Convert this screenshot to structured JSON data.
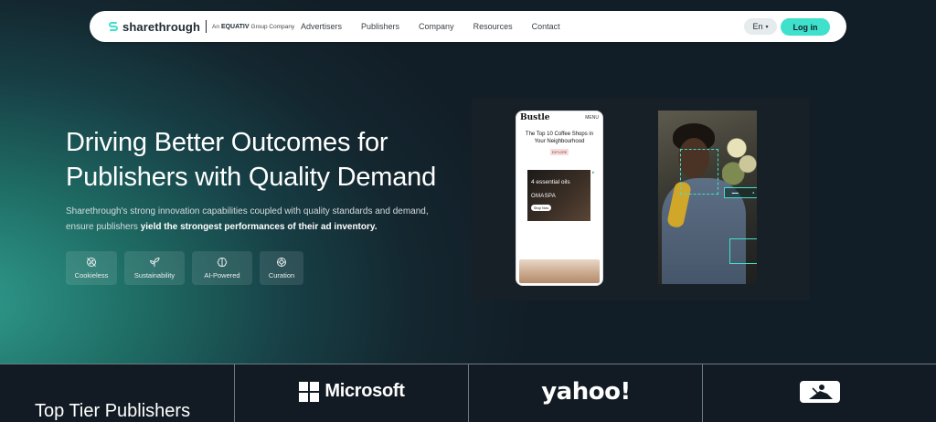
{
  "nav": {
    "brand": "sharethrough",
    "brand_sub_prefix": "An",
    "brand_sub_company": "EQUATIV",
    "brand_sub_suffix": "Group Company",
    "links": [
      "Advertisers",
      "Publishers",
      "Company",
      "Resources",
      "Contact"
    ],
    "language": "En",
    "login_label": "Log in",
    "accent_color": "#3fe0cc"
  },
  "hero": {
    "headline_line1": "Driving Better Outcomes for",
    "headline_line2": "Publishers with Quality Demand",
    "description_lead": "Sharethrough's strong innovation capabilities coupled with quality standards and demand, ensure publishers ",
    "description_bold": "yield the strongest performances of their ad inventory.",
    "features": [
      {
        "label": "Cookieless",
        "icon": "cookieless-icon"
      },
      {
        "label": "Sustainability",
        "icon": "sprout-icon"
      },
      {
        "label": "AI-Powered",
        "icon": "brain-icon"
      },
      {
        "label": "Curation",
        "icon": "curation-icon"
      }
    ]
  },
  "showcase": {
    "phone_brand": "Bustle",
    "phone_menu": "MENU",
    "phone_title": "The Top 10 Coffee Shops in Your Neighbourhood",
    "phone_button": "EXPLORE",
    "ad_big_text": "4 essential oils",
    "ad_brand": "OMASPA",
    "ad_cta": "Shop Now"
  },
  "publishers": {
    "heading": "Top Tier Publishers",
    "logos": [
      "Microsoft",
      "yahoo!",
      "mlb-logo"
    ]
  }
}
